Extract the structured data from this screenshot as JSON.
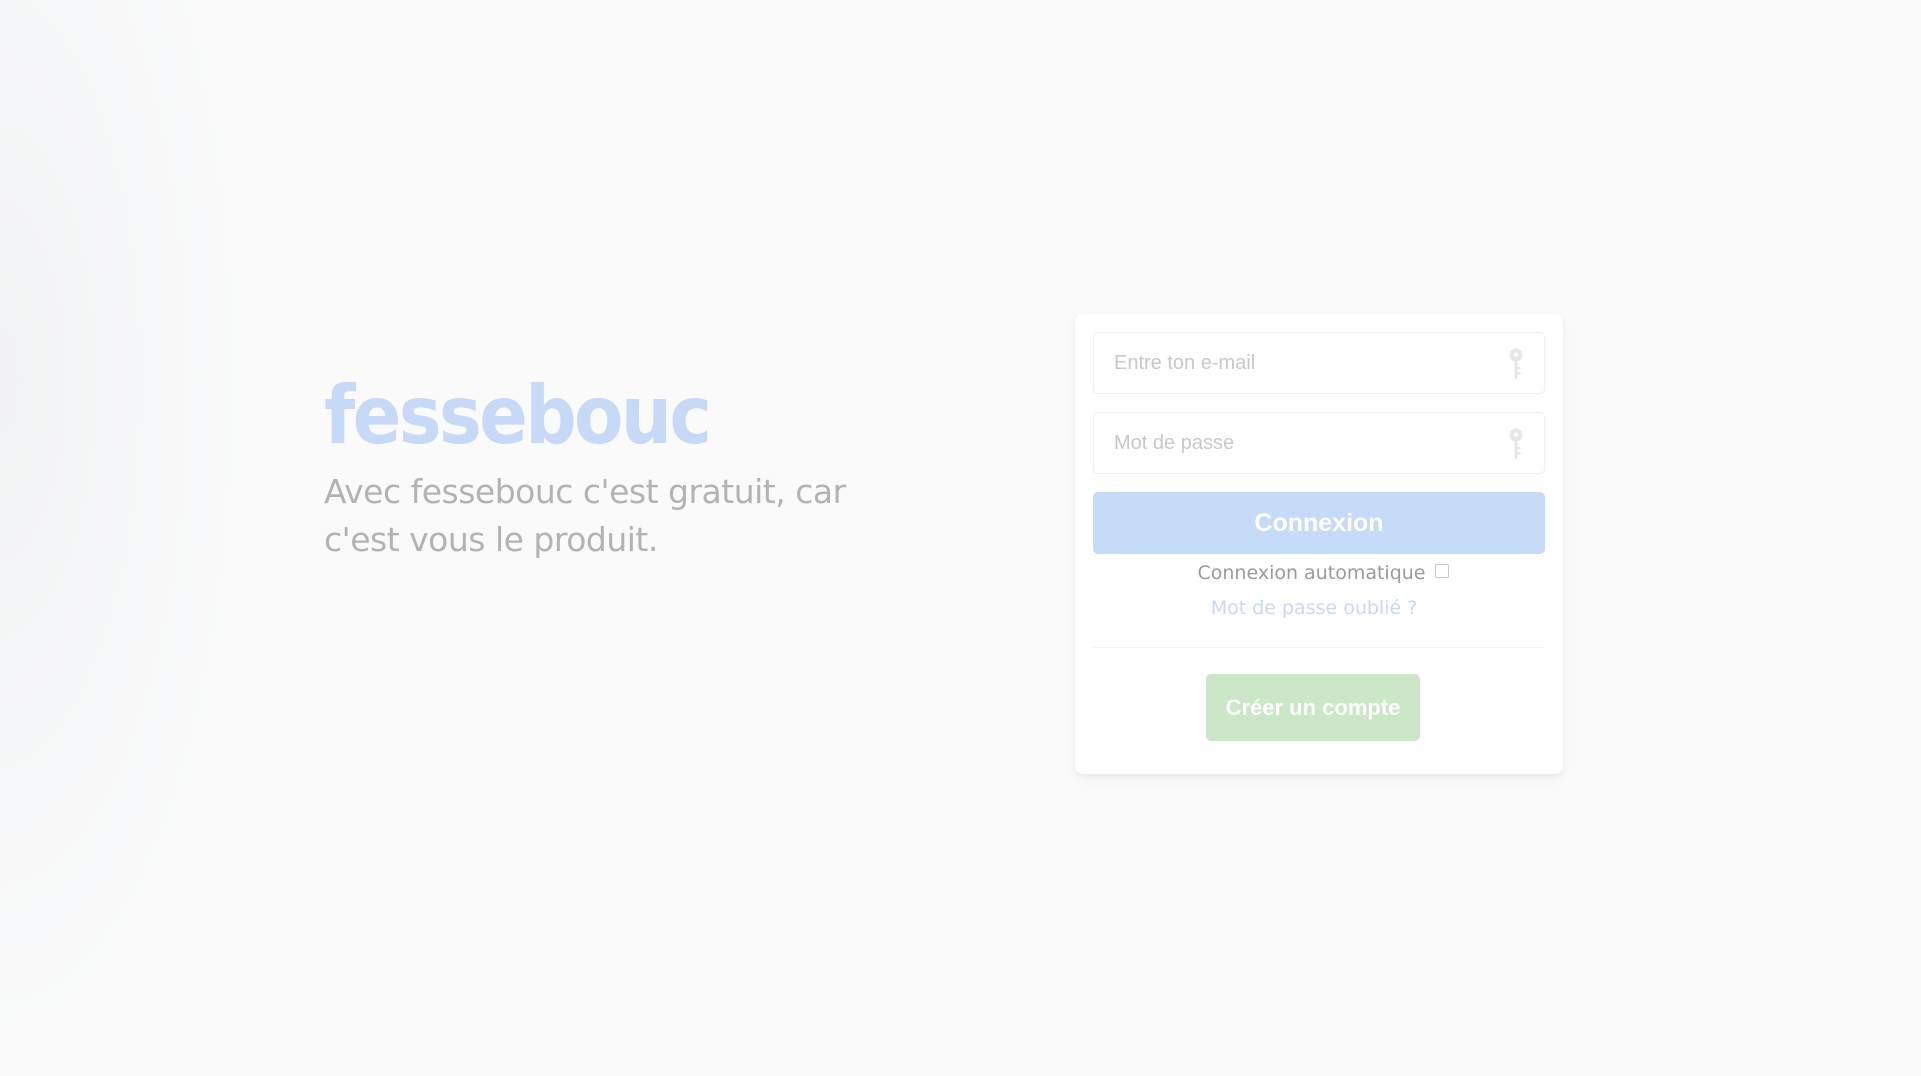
{
  "brand": {
    "name": "fessebouc",
    "tagline": "Avec fessebouc c'est gratuit, car c'est vous le produit."
  },
  "login_form": {
    "email_placeholder": "Entre ton e-mail",
    "email_icon": "key-icon",
    "password_placeholder": "Mot de passe",
    "password_icon": "key-icon",
    "login_label": "Connexion",
    "auto_login_label": "Connexion automatique",
    "auto_login_checked": false,
    "forgot_label": "Mot de passe oublié ?",
    "create_account_label": "Créer un compte"
  },
  "colors": {
    "brand": "#c6daf7",
    "login_button": "#c6dbf8",
    "create_button": "#cce6c8",
    "forgot_link": "#c6d9f5"
  }
}
